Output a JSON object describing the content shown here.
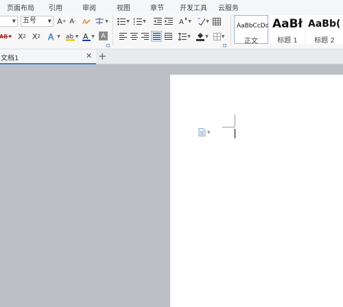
{
  "menu": [
    "页面布局",
    "引用",
    "审阅",
    "视图",
    "章节",
    "开发工具",
    "云服务"
  ],
  "font": {
    "name": "",
    "size": "五号"
  },
  "styles": [
    {
      "preview": "AaBbCcDd",
      "name": "正文"
    },
    {
      "preview": "AaBł",
      "name": "标题 1"
    },
    {
      "preview": "AaBb(",
      "name": "标题 2"
    }
  ],
  "tabs": [
    {
      "label": "文档1"
    }
  ],
  "colors": {
    "accent": "#3f7fd0",
    "font_color": "#1a3aa8",
    "highlight": "#e8d030",
    "workspace": "#bcc0c5"
  }
}
